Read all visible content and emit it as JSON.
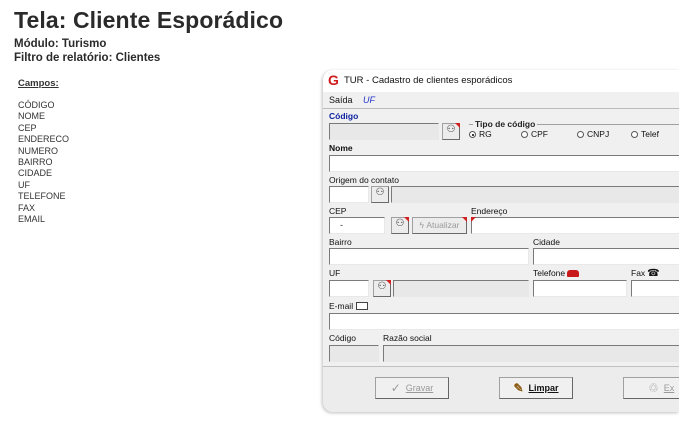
{
  "page": {
    "title": "Tela: Cliente Esporádico",
    "module": "Módulo: Turismo",
    "report_filter": "Filtro de relatório: Clientes"
  },
  "fields": {
    "heading": "Campos:",
    "items": [
      "CÓDIGO",
      "NOME",
      "CEP",
      "ENDERECO",
      "NUMERO",
      "BAIRRO",
      "CIDADE",
      "UF",
      "TELEFONE",
      "FAX",
      "EMAIL"
    ]
  },
  "window": {
    "title": "TUR - Cadastro de clientes esporádicos",
    "menu": [
      "Saída",
      "UF"
    ],
    "labels": {
      "codigo": "Código",
      "tipo_codigo": "Tipo de código",
      "nome": "Nome",
      "origem": "Origem do contato",
      "cep": "CEP",
      "endereco": "Endereço",
      "bairro": "Bairro",
      "cidade": "Cidade",
      "uf": "UF",
      "telefone": "Telefone",
      "fax": "Fax",
      "email": "E-mail",
      "codigo2": "Código",
      "razao": "Razão social"
    },
    "radio_options": [
      "RG",
      "CPF",
      "CNPJ",
      "Telef"
    ],
    "radio_selected": "RG",
    "cep_value": "-",
    "atualizar": "Atualizar",
    "buttons": {
      "gravar": "Gravar",
      "limpar": "Limpar",
      "excluir": "Ex"
    }
  },
  "icons": {
    "binoculars": "binoculars-icon",
    "app": "tur-app-icon"
  },
  "colors": {
    "red_marker": "#d02020",
    "menu_blue": "#2233cc",
    "label_blue": "#0a1ea0"
  }
}
